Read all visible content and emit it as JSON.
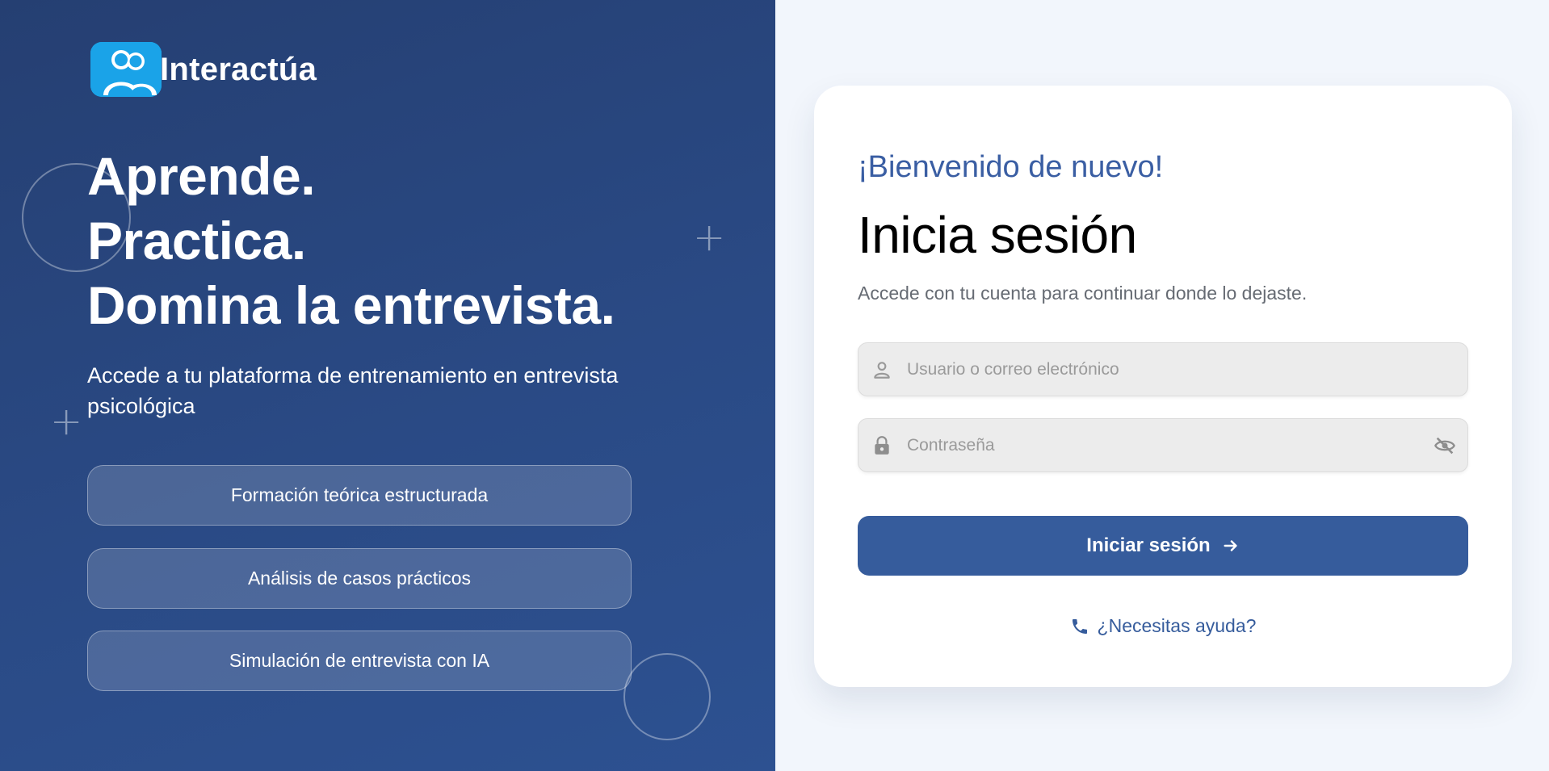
{
  "brand": {
    "name": "Interactúa",
    "logo_icon": "two-people-icon",
    "logo_color": "#1aa3e8"
  },
  "hero": {
    "lines": [
      "Aprende.",
      "Practica.",
      "Domina la entrevista."
    ],
    "subtitle": "Accede a tu plataforma de entrenamiento en entrevista psicológica",
    "features": [
      "Formación teórica estructurada",
      "Análisis de casos prácticos",
      "Simulación de entrevista con IA"
    ]
  },
  "login": {
    "welcome": "¡Bienvenido de nuevo!",
    "title": "Inicia sesión",
    "description": "Accede con tu cuenta para continuar donde lo dejaste.",
    "username_placeholder": "Usuario o correo electrónico",
    "username_value": "",
    "password_placeholder": "Contraseña",
    "password_value": "",
    "submit_label": "Iniciar sesión",
    "help_label": "¿Necesitas ayuda?"
  },
  "colors": {
    "left_panel": "#2a4a85",
    "accent": "#365c9c",
    "welcome_text": "#3a5ea3",
    "right_bg": "#f2f6fc"
  },
  "icons": {
    "username": "person-icon",
    "password": "lock-icon",
    "toggle_password": "eye-off-icon",
    "submit": "arrow-right-icon",
    "help": "phone-icon"
  }
}
